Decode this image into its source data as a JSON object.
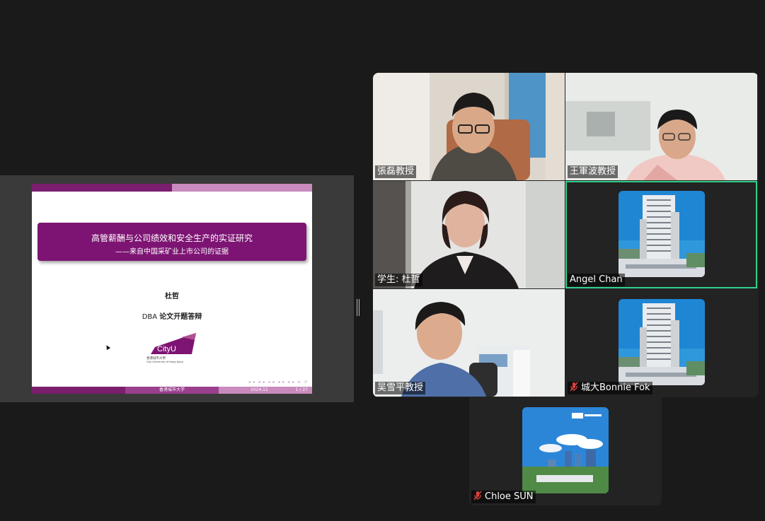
{
  "shared_screen": {
    "slide": {
      "title": "高管薪酬与公司绩效和安全生产的实证研究",
      "subtitle": "——来自中国采矿业上市公司的证据",
      "author": "杜哲",
      "defense_prefix": "DBA",
      "defense_label": "论文开题答辩",
      "logo_text": "CityU",
      "logo_cn": "香港城市大學",
      "logo_en": "City University of Hong Kong",
      "nav_icons": "◂ ▸ ◂ ▸ ◂ ▸ ◂ ▸ ◂ ▸ ≡ ↺",
      "footer_institution": "香港城市大学",
      "footer_date": "2024.11",
      "footer_page": "1 / 27"
    }
  },
  "participants": [
    {
      "name": "張磊教授",
      "type": "video",
      "muted": false
    },
    {
      "name": "王軍波教授",
      "type": "video",
      "muted": false
    },
    {
      "name": "学生: 杜哲",
      "type": "video",
      "muted": false
    },
    {
      "name": "Angel Chan",
      "type": "avatar",
      "muted": false,
      "active_speaker": true
    },
    {
      "name": "吴雪平教授",
      "type": "video",
      "muted": false
    },
    {
      "name": "城大Bonnie Fok",
      "type": "avatar",
      "muted": true
    },
    {
      "name": "Chloe SUN",
      "type": "avatar",
      "muted": true
    }
  ],
  "colors": {
    "cityu_purple": "#7d1473",
    "active_speaker_border": "#2fd18a",
    "muted_mic": "#e0413a",
    "background": "#1a1a1a"
  }
}
